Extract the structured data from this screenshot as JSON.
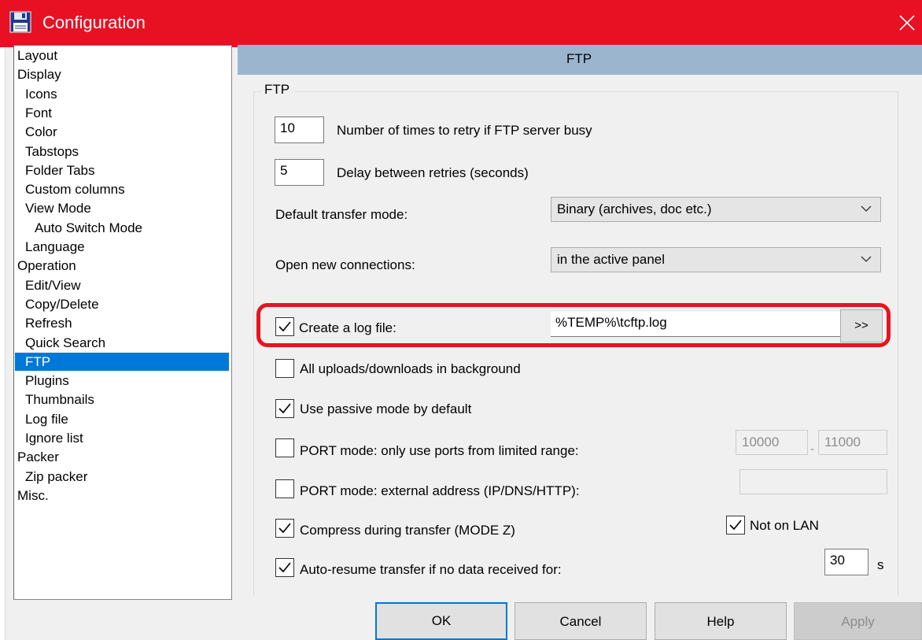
{
  "window": {
    "title": "Configuration"
  },
  "tree": {
    "items": [
      {
        "label": "Layout",
        "level": 0
      },
      {
        "label": "Display",
        "level": 0
      },
      {
        "label": "Icons",
        "level": 1
      },
      {
        "label": "Font",
        "level": 1
      },
      {
        "label": "Color",
        "level": 1
      },
      {
        "label": "Tabstops",
        "level": 1
      },
      {
        "label": "Folder Tabs",
        "level": 1
      },
      {
        "label": "Custom columns",
        "level": 1
      },
      {
        "label": "View Mode",
        "level": 1
      },
      {
        "label": "Auto Switch Mode",
        "level": 2
      },
      {
        "label": "Language",
        "level": 1
      },
      {
        "label": "Operation",
        "level": 0
      },
      {
        "label": "Edit/View",
        "level": 1
      },
      {
        "label": "Copy/Delete",
        "level": 1
      },
      {
        "label": "Refresh",
        "level": 1
      },
      {
        "label": "Quick Search",
        "level": 1
      },
      {
        "label": "FTP",
        "level": 1,
        "selected": true
      },
      {
        "label": "Plugins",
        "level": 1
      },
      {
        "label": "Thumbnails",
        "level": 1
      },
      {
        "label": "Log file",
        "level": 1
      },
      {
        "label": "Ignore list",
        "level": 1
      },
      {
        "label": "Packer",
        "level": 0
      },
      {
        "label": "Zip packer",
        "level": 1
      },
      {
        "label": "Misc.",
        "level": 0
      }
    ]
  },
  "panel": {
    "header": "FTP",
    "group_title": "FTP",
    "retry_count": "10",
    "retry_label": "Number of times to retry if FTP server busy",
    "delay_value": "5",
    "delay_label": "Delay between retries (seconds)",
    "transfer_mode_label": "Default transfer mode:",
    "transfer_mode_value": "Binary (archives, doc etc.)",
    "open_connections_label": "Open new connections:",
    "open_connections_value": "in the active panel",
    "log_file_label": "Create a log file:",
    "log_file_path": "%TEMP%\\tcftp.log",
    "browse_label": ">>",
    "background_label": "All uploads/downloads in background",
    "passive_label": "Use passive mode by default",
    "port_range_label": "PORT mode: only use ports from limited range:",
    "port_from": "10000",
    "port_to": "11000",
    "port_external_label": "PORT mode: external address (IP/DNS/HTTP):",
    "compress_label": "Compress during transfer (MODE Z)",
    "not_on_lan_label": "Not on LAN",
    "auto_resume_label": "Auto-resume transfer if no data received for:",
    "auto_resume_value": "30",
    "auto_resume_unit": "s"
  },
  "checkboxes": {
    "create_log": true,
    "background": false,
    "passive": true,
    "port_range": false,
    "port_external": false,
    "compress": true,
    "not_on_lan": true,
    "auto_resume": true
  },
  "buttons": {
    "ok": "OK",
    "cancel": "Cancel",
    "help": "Help",
    "apply": "Apply"
  },
  "colors": {
    "titlebar": "#e81123",
    "selection": "#0078d7",
    "header_band": "#9cb5cf",
    "highlight": "#e8131f"
  }
}
